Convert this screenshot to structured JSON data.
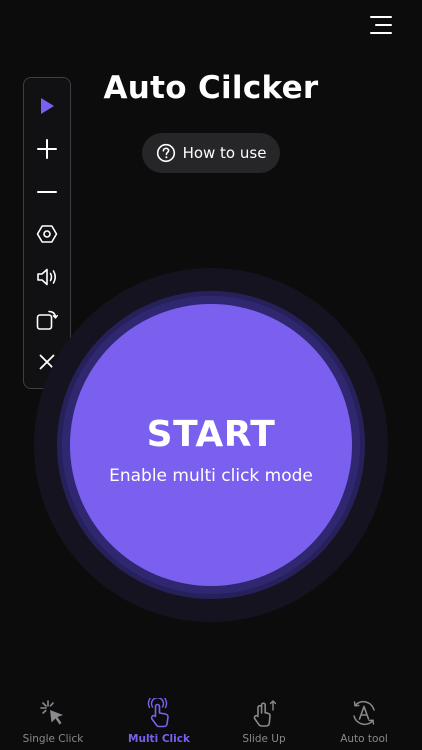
{
  "header": {
    "title": "Auto Cilcker",
    "menu_icon": "hamburger-menu-icon",
    "how_to_use_label": "How to use",
    "how_to_use_icon": "question-circle-icon"
  },
  "toolbar": {
    "items": [
      {
        "name": "play",
        "icon": "play-icon"
      },
      {
        "name": "add",
        "icon": "plus-icon"
      },
      {
        "name": "remove",
        "icon": "minus-icon"
      },
      {
        "name": "settings",
        "icon": "hexagon-gear-icon"
      },
      {
        "name": "sound",
        "icon": "speaker-icon"
      },
      {
        "name": "rotate",
        "icon": "rotate-icon"
      },
      {
        "name": "close",
        "icon": "close-icon"
      }
    ]
  },
  "main": {
    "start_label": "START",
    "start_subtitle": "Enable multi click mode"
  },
  "tabs": [
    {
      "label": "Single Click",
      "icon": "cursor-click-icon",
      "active": false
    },
    {
      "label": "Multi Click",
      "icon": "multi-tap-icon",
      "active": true
    },
    {
      "label": "Slide Up",
      "icon": "swipe-up-icon",
      "active": false
    },
    {
      "label": "Auto tool",
      "icon": "auto-icon",
      "active": false
    }
  ],
  "colors": {
    "accent": "#7b60f0",
    "background": "#0c0c0d",
    "inactive_tab": "#8a8a8e"
  }
}
